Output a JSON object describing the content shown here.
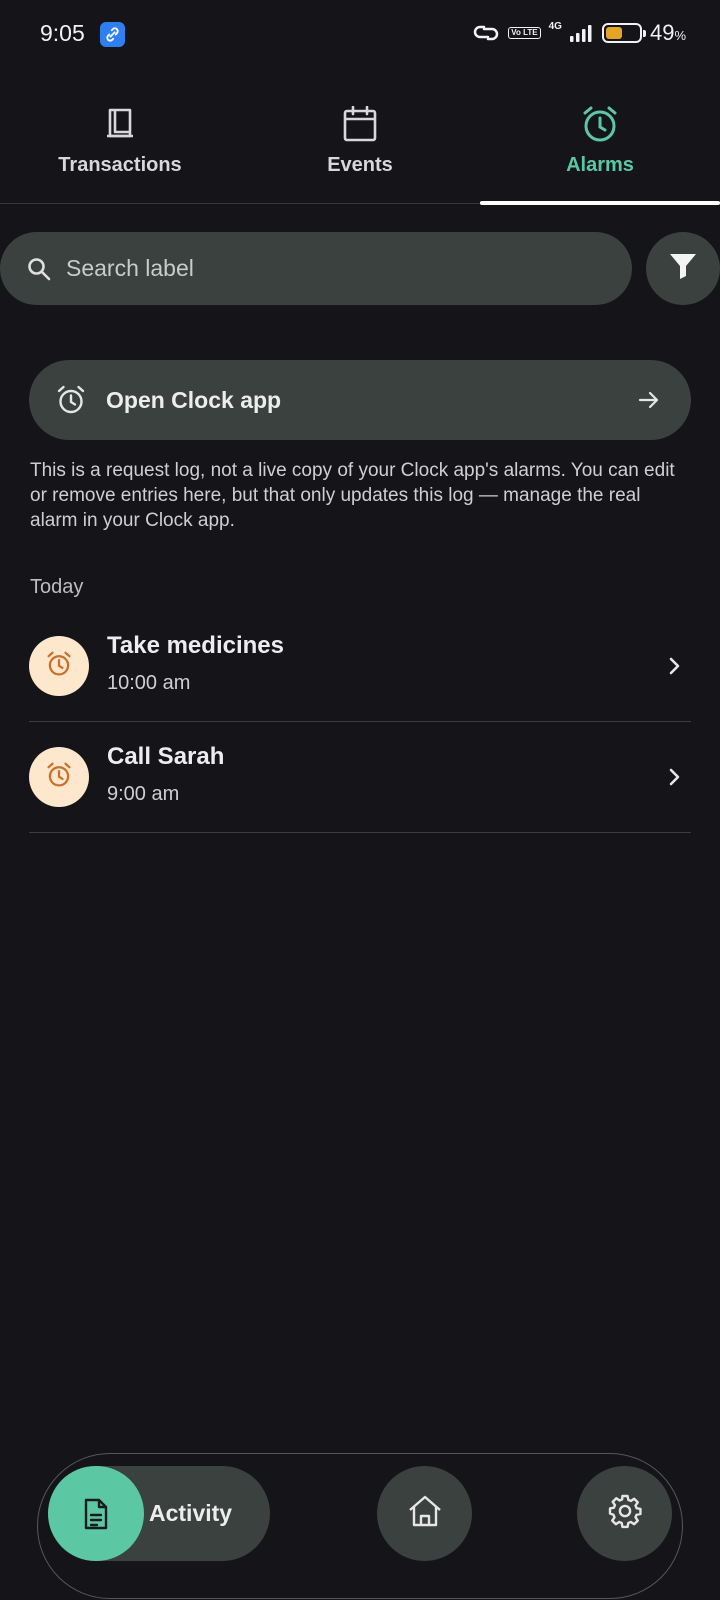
{
  "status_bar": {
    "time": "9:05",
    "network": "4G",
    "volte": "Vo LTE",
    "battery_percent": "49",
    "battery_unit": "%",
    "battery_level": 0.49
  },
  "tabs": [
    {
      "label": "Transactions",
      "icon": "receipt-icon",
      "active": false
    },
    {
      "label": "Events",
      "icon": "calendar-icon",
      "active": false
    },
    {
      "label": "Alarms",
      "icon": "alarm-icon",
      "active": true
    }
  ],
  "search": {
    "placeholder": "Search label",
    "value": ""
  },
  "open_clock": {
    "label": "Open Clock app"
  },
  "info_text": "This is a request log, not a live copy of your Clock app's alarms. You can edit or remove entries here, but that only updates this log — manage the real alarm in your Clock app.",
  "section": {
    "title": "Today"
  },
  "alarms": [
    {
      "title": "Take medicines",
      "time": "10:00 am"
    },
    {
      "title": "Call Sarah",
      "time": "9:00 am"
    }
  ],
  "bottom_nav": {
    "activity_label": "Activity"
  },
  "colors": {
    "background": "#141419",
    "accent": "#5cc8a3",
    "surface": "#3a413e",
    "alarm_avatar": "#fde7cd",
    "alarm_icon": "#c8702a",
    "battery": "#e3a526"
  }
}
